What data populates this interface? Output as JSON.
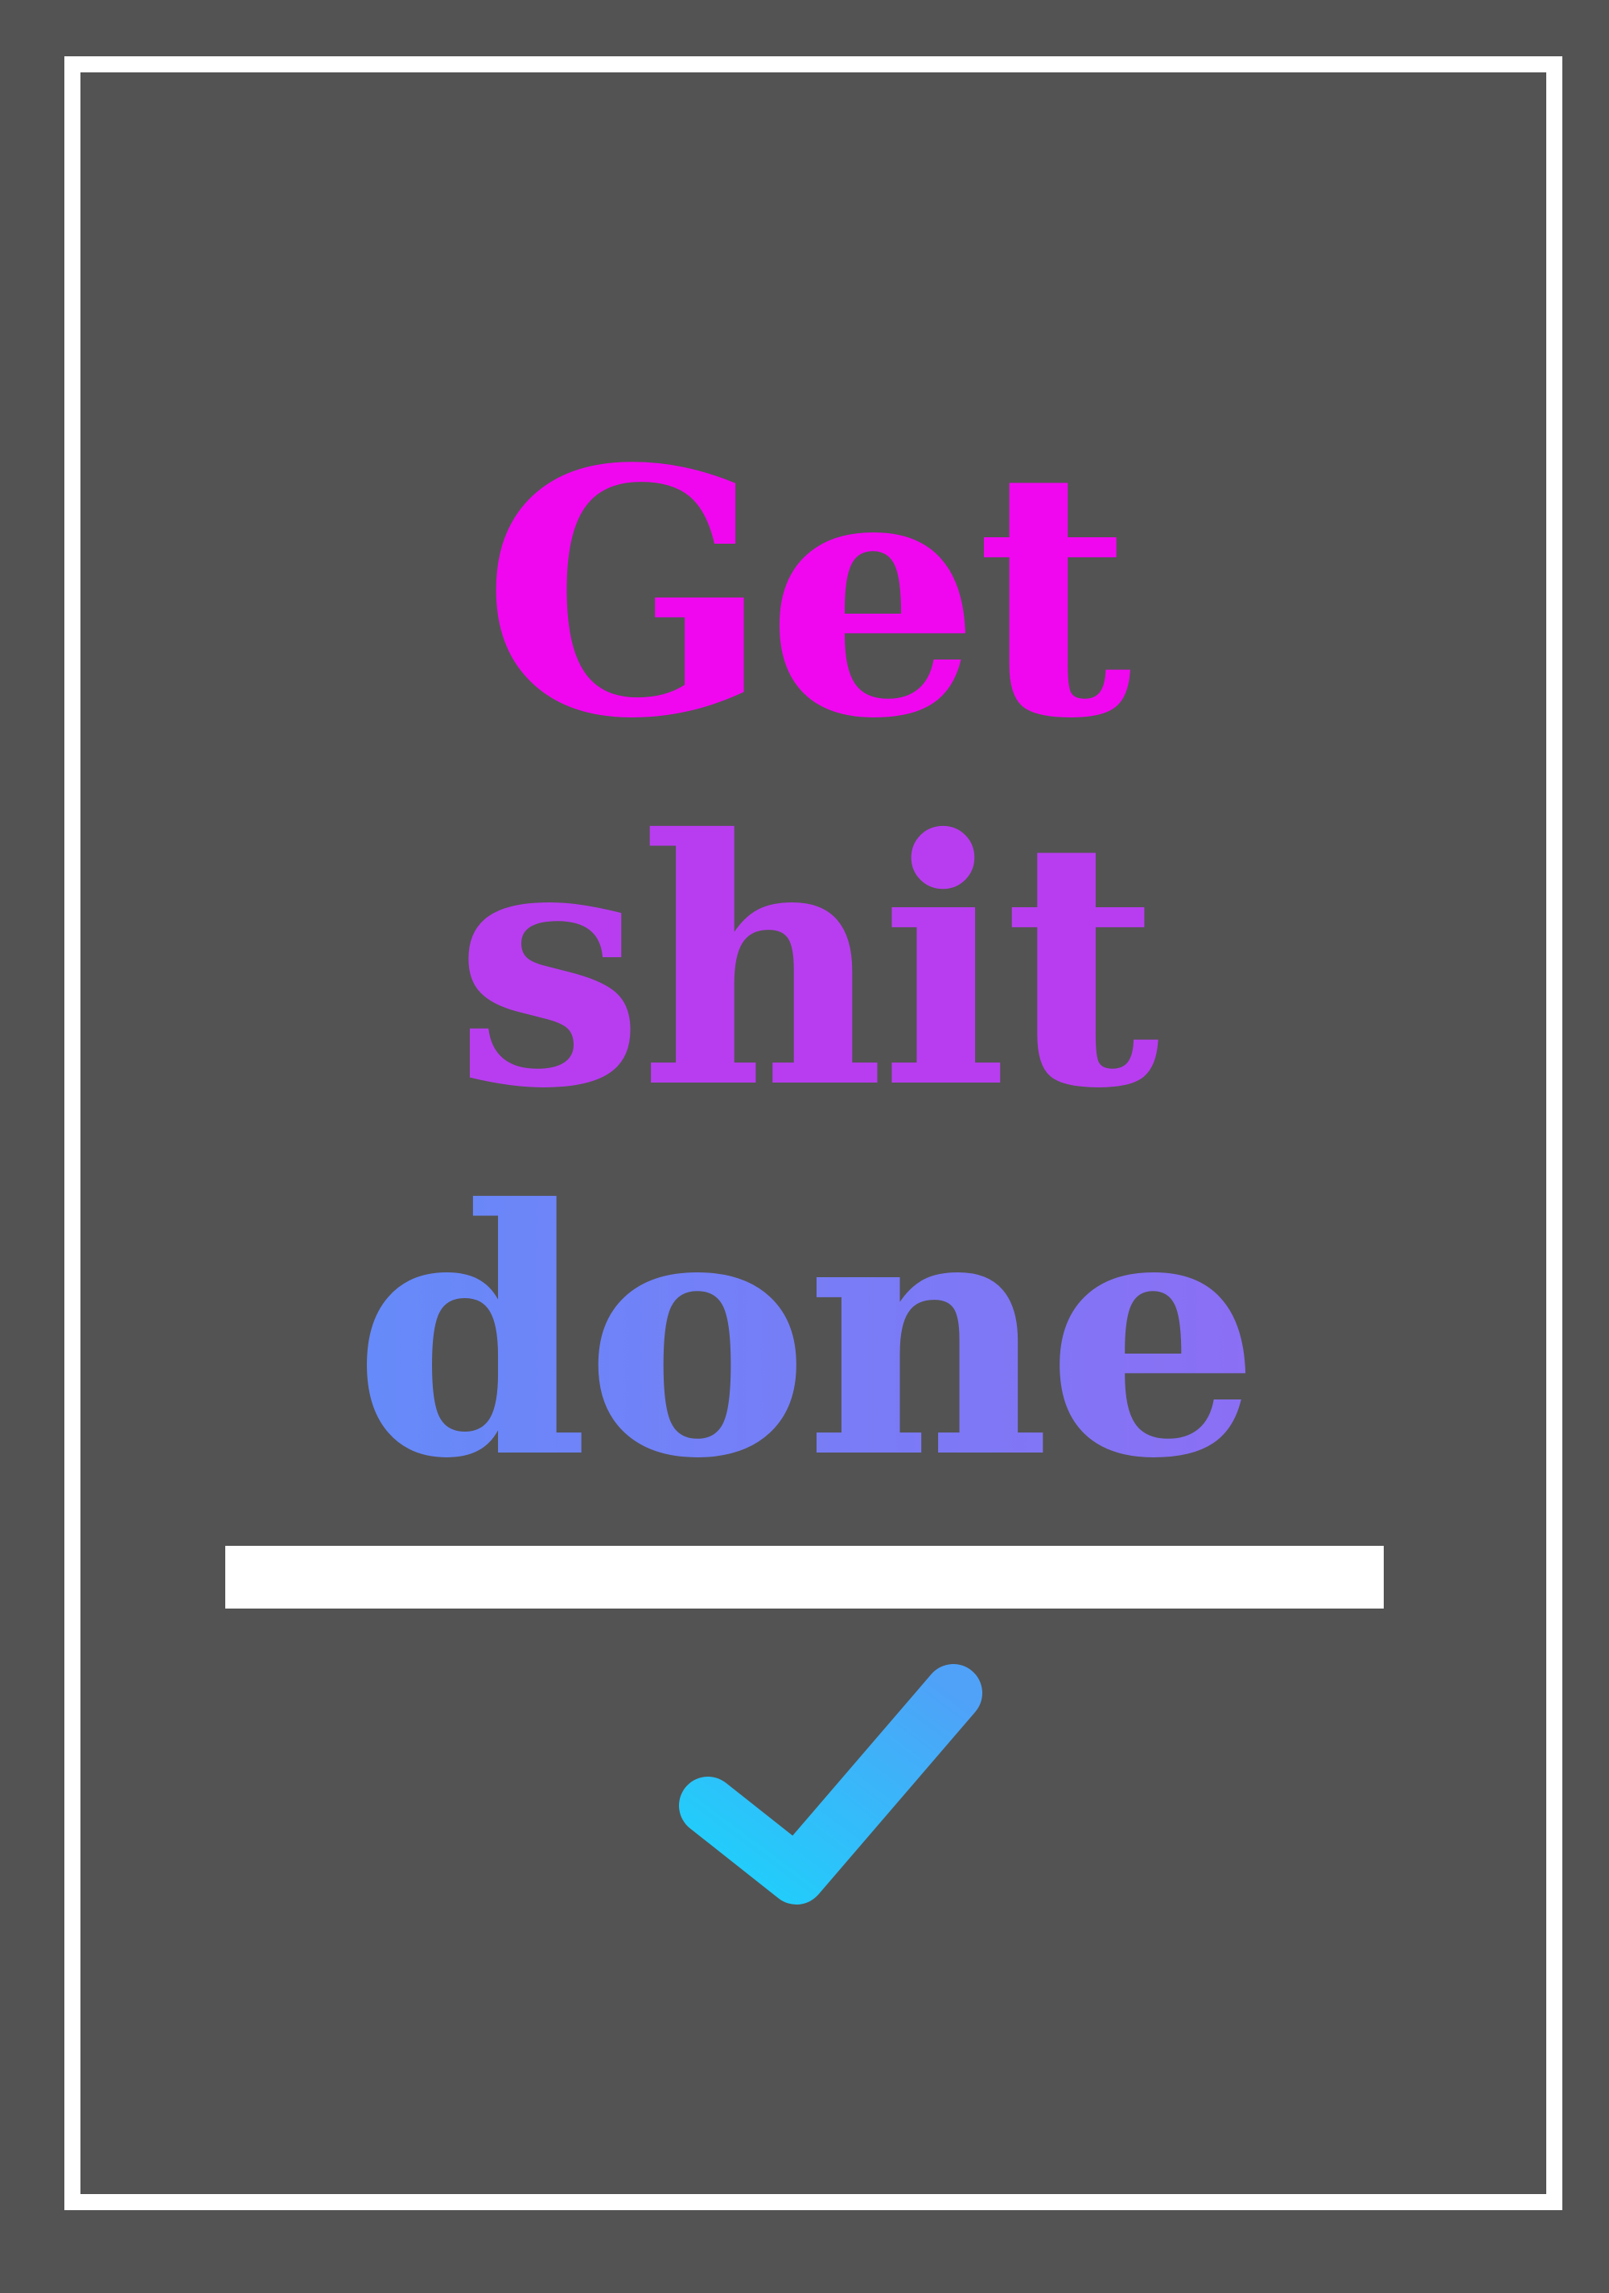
{
  "poster": {
    "line1": "Get",
    "line2": "shit",
    "line3": "done",
    "colors": {
      "background": "#535353",
      "frame": "#ffffff",
      "line1": "#f007f0",
      "line2": "#b83df0",
      "line3_start": "#5895fb",
      "line3_end": "#9c62f2",
      "check_start": "#1ed0fb",
      "check_end": "#4fa2f8"
    },
    "icon": "checkmark-icon"
  }
}
